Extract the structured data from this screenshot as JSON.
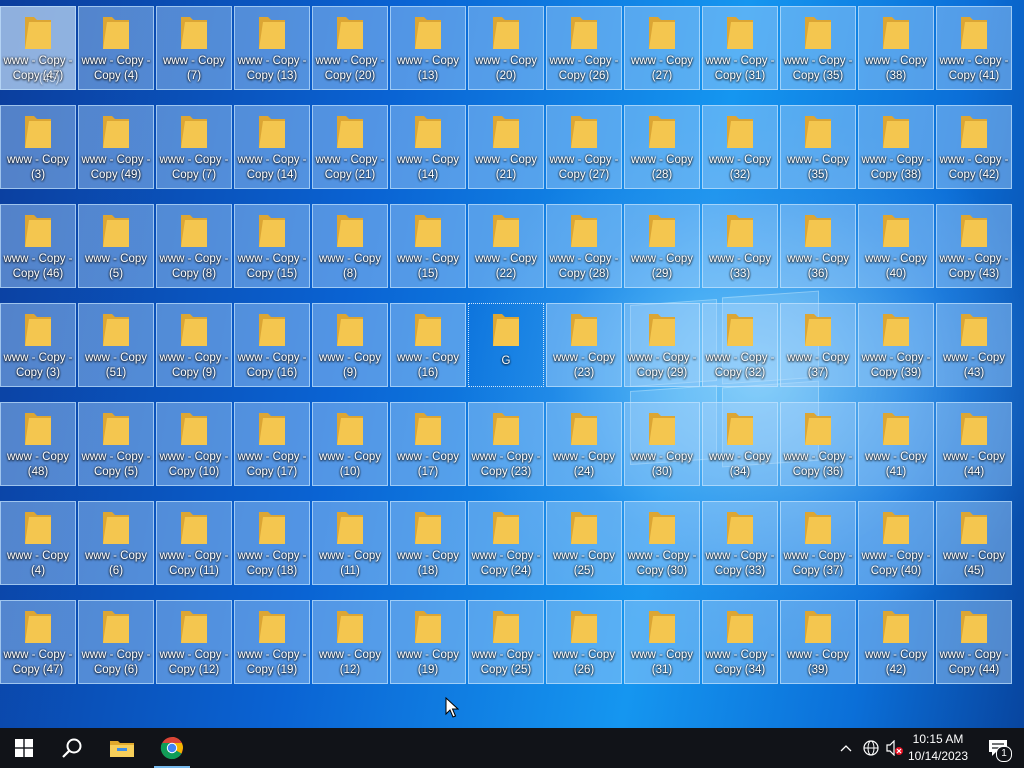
{
  "desktop": {
    "rows": [
      [
        {
          "label": "www - Copy - Copy (47)",
          "overlay": "(45)",
          "hl": true
        },
        {
          "label": "www - Copy - Copy (4)"
        },
        {
          "label": "www - Copy (7)"
        },
        {
          "label": "www - Copy - Copy (13)"
        },
        {
          "label": "www - Copy - Copy (20)"
        },
        {
          "label": "www - Copy (13)"
        },
        {
          "label": "www - Copy (20)"
        },
        {
          "label": "www - Copy - Copy (26)"
        },
        {
          "label": "www - Copy (27)"
        },
        {
          "label": "www - Copy - Copy (31)"
        },
        {
          "label": "www - Copy - Copy (35)"
        },
        {
          "label": "www - Copy (38)"
        },
        {
          "label": "www - Copy - Copy (41)"
        }
      ],
      [
        {
          "label": "www - Copy (3)"
        },
        {
          "label": "www - Copy - Copy (49)"
        },
        {
          "label": "www - Copy - Copy (7)"
        },
        {
          "label": "www - Copy - Copy (14)"
        },
        {
          "label": "www - Copy - Copy (21)"
        },
        {
          "label": "www - Copy (14)"
        },
        {
          "label": "www - Copy (21)"
        },
        {
          "label": "www - Copy - Copy (27)"
        },
        {
          "label": "www - Copy (28)"
        },
        {
          "label": "www - Copy (32)"
        },
        {
          "label": "www - Copy (35)"
        },
        {
          "label": "www - Copy - Copy (38)"
        },
        {
          "label": "www - Copy - Copy (42)"
        }
      ],
      [
        {
          "label": "www - Copy - Copy (46)"
        },
        {
          "label": "www - Copy (5)"
        },
        {
          "label": "www - Copy - Copy (8)"
        },
        {
          "label": "www - Copy - Copy (15)"
        },
        {
          "label": "www - Copy (8)"
        },
        {
          "label": "www - Copy (15)"
        },
        {
          "label": "www - Copy (22)"
        },
        {
          "label": "www - Copy - Copy (28)"
        },
        {
          "label": "www - Copy (29)"
        },
        {
          "label": "www - Copy (33)"
        },
        {
          "label": "www - Copy (36)"
        },
        {
          "label": "www - Copy (40)"
        },
        {
          "label": "www - Copy - Copy (43)"
        }
      ],
      [
        {
          "label": "www - Copy - Copy (3)"
        },
        {
          "label": "www - Copy (51)"
        },
        {
          "label": "www - Copy - Copy (9)"
        },
        {
          "label": "www - Copy - Copy (16)"
        },
        {
          "label": "www - Copy (9)"
        },
        {
          "label": "www - Copy (16)"
        },
        {
          "label": "G",
          "plain": true
        },
        {
          "label": "www - Copy (23)"
        },
        {
          "label": "www - Copy - Copy (29)"
        },
        {
          "label": "www - Copy - Copy (32)"
        },
        {
          "label": "www - Copy (37)"
        },
        {
          "label": "www - Copy - Copy (39)"
        },
        {
          "label": "www - Copy (43)"
        }
      ],
      [
        {
          "label": "www - Copy (48)"
        },
        {
          "label": "www - Copy - Copy (5)"
        },
        {
          "label": "www - Copy - Copy (10)"
        },
        {
          "label": "www - Copy - Copy (17)"
        },
        {
          "label": "www - Copy (10)"
        },
        {
          "label": "www - Copy (17)"
        },
        {
          "label": "www - Copy - Copy (23)"
        },
        {
          "label": "www - Copy (24)"
        },
        {
          "label": "www - Copy (30)"
        },
        {
          "label": "www - Copy (34)"
        },
        {
          "label": "www - Copy - Copy (36)"
        },
        {
          "label": "www - Copy (41)"
        },
        {
          "label": "www - Copy (44)"
        }
      ],
      [
        {
          "label": "www - Copy (4)"
        },
        {
          "label": "www - Copy (6)"
        },
        {
          "label": "www - Copy - Copy (11)"
        },
        {
          "label": "www - Copy - Copy (18)"
        },
        {
          "label": "www - Copy (11)"
        },
        {
          "label": "www - Copy (18)"
        },
        {
          "label": "www - Copy - Copy (24)"
        },
        {
          "label": "www - Copy (25)"
        },
        {
          "label": "www - Copy - Copy (30)"
        },
        {
          "label": "www - Copy - Copy (33)"
        },
        {
          "label": "www - Copy - Copy (37)"
        },
        {
          "label": "www - Copy - Copy (40)"
        },
        {
          "label": "www - Copy (45)"
        }
      ],
      [
        {
          "label": "www - Copy - Copy (47)"
        },
        {
          "label": "www - Copy - Copy (6)"
        },
        {
          "label": "www - Copy - Copy (12)"
        },
        {
          "label": "www - Copy - Copy (19)"
        },
        {
          "label": "www - Copy (12)"
        },
        {
          "label": "www - Copy (19)"
        },
        {
          "label": "www - Copy - Copy (25)"
        },
        {
          "label": "www - Copy (26)"
        },
        {
          "label": "www - Copy (31)"
        },
        {
          "label": "www - Copy - Copy (34)"
        },
        {
          "label": "www - Copy (39)"
        },
        {
          "label": "www - Copy (42)"
        },
        {
          "label": "www - Copy - Copy (44)"
        }
      ]
    ],
    "folder_icon": "folder-icon"
  },
  "taskbar": {
    "start": "windows-start-icon",
    "search": "search-icon",
    "pinned": [
      {
        "name": "file-explorer-icon"
      },
      {
        "name": "chrome-icon",
        "active": true
      }
    ],
    "tray": {
      "overflow": "chevron-up-icon",
      "network": "network-icon",
      "volume": "volume-muted-icon",
      "time": "10:15 AM",
      "date": "10/14/2023",
      "notification_count": "1"
    }
  },
  "colors": {
    "folder": "#f4c64f",
    "folder_dark": "#dca634",
    "taskbar": "#111318",
    "accent": "#76b9ed"
  }
}
